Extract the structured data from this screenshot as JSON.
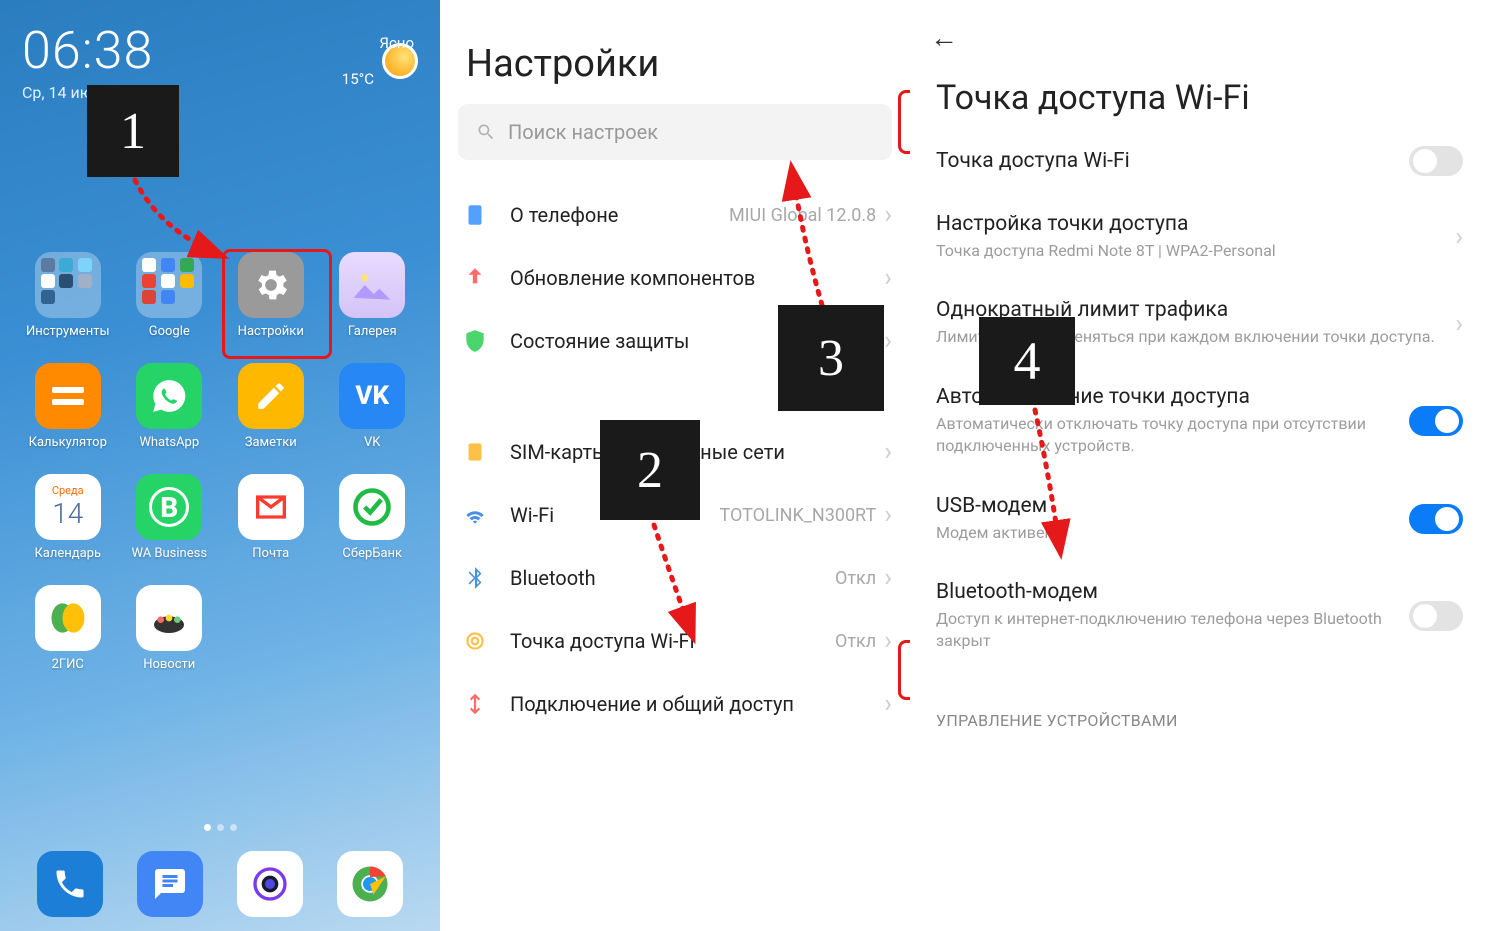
{
  "panel1": {
    "time": "06:38",
    "date": "Ср, 14 июля",
    "weather": {
      "cond": "Ясно",
      "temp": "15°C"
    },
    "apps_row1": [
      {
        "label": "Инструменты"
      },
      {
        "label": "Google"
      },
      {
        "label": "Настройки"
      },
      {
        "label": "Галерея"
      }
    ],
    "apps_row2": [
      {
        "label": "Калькулятор"
      },
      {
        "label": "WhatsApp"
      },
      {
        "label": "Заметки"
      },
      {
        "label": "VK"
      }
    ],
    "apps_row3": [
      {
        "label": "Календарь",
        "day_name": "Среда",
        "day_num": "14"
      },
      {
        "label": "WA Business"
      },
      {
        "label": "Почта"
      },
      {
        "label": "СберБанк"
      }
    ],
    "apps_row4": [
      {
        "label": "2ГИС"
      },
      {
        "label": "Новости"
      }
    ]
  },
  "panel2": {
    "title": "Настройки",
    "search_placeholder": "Поиск настроек",
    "items": [
      {
        "label": "О телефоне",
        "value": "MIUI Global 12.0.8"
      },
      {
        "label": "Обновление компонентов",
        "value": ""
      },
      {
        "label": "Состояние защиты",
        "value": ""
      },
      {
        "label": "SIM-карты и мобильные сети",
        "value": ""
      },
      {
        "label": "Wi-Fi",
        "value": "TOTOLINK_N300RT"
      },
      {
        "label": "Bluetooth",
        "value": "Откл"
      },
      {
        "label": "Точка доступа Wi-Fi",
        "value": "Откл"
      },
      {
        "label": "Подключение и общий доступ",
        "value": ""
      }
    ]
  },
  "panel3": {
    "title": "Точка доступа Wi-Fi",
    "items": {
      "hotspot": {
        "title": "Точка доступа Wi-Fi",
        "on": false
      },
      "setup": {
        "title": "Настройка точки доступа",
        "sub": "Точка доступа Redmi Note 8T | WPA2-Personal"
      },
      "limit": {
        "title": "Однократный лимит трафика",
        "sub": "Лимит будет применяться при каждом включении точки доступа."
      },
      "auto_off": {
        "title": "Автоотключение точки доступа",
        "sub": "Автоматически отключать точку доступа при отсутствии подключенных устройств.",
        "on": true
      },
      "usb": {
        "title": "USB-модем",
        "sub": "Модем активен",
        "on": true
      },
      "bt": {
        "title": "Bluetooth-модем",
        "sub": "Доступ к интернет-подключению телефона через Bluetooth закрыт",
        "on": false
      }
    },
    "section": "УПРАВЛЕНИЕ УСТРОЙСТВАМИ"
  },
  "steps": {
    "1": "1",
    "2": "2",
    "3": "3",
    "4": "4"
  }
}
